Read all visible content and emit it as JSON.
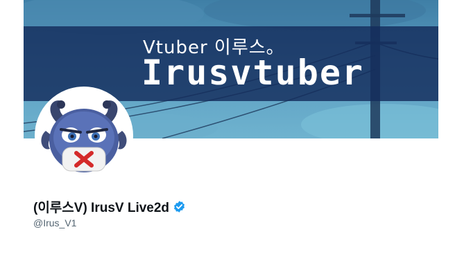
{
  "banner": {
    "subtitle": "Vtuber 이루스。",
    "title": "Irusvtuber"
  },
  "profile": {
    "display_name": "(이루스V) IrusV Live2d",
    "handle": "@Irus_V1",
    "verified": true,
    "verified_color": "#1d9bf0"
  },
  "colors": {
    "banner_band": "#142c5c",
    "banner_sky": "#5a9cc0"
  },
  "icons": {
    "verified": "verified-badge-icon"
  }
}
